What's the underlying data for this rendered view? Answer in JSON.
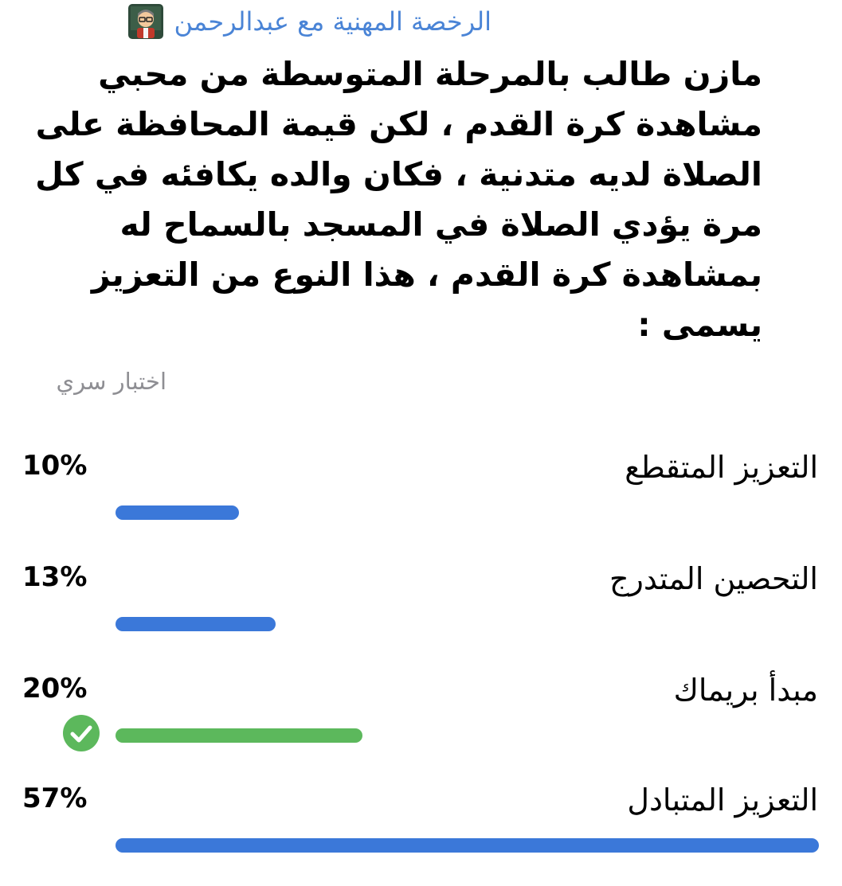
{
  "author": {
    "name": "الرخصة المهنية مع عبدالرحمن",
    "emoji_icon": "teacher-emoji-icon"
  },
  "question": "مازن طالب بالمرحلة المتوسطة من محبي مشاهدة كرة القدم ، لكن قيمة المحافظة على الصلاة لديه متدنية ، فكان والده يكافئه في كل مرة يؤدي الصلاة في المسجد بالسماح له بمشاهدة كرة القدم ، هذا النوع من التعزيز يسمى :",
  "poll_type": "اختبار سري",
  "colors": {
    "accent": "#3b78d9",
    "correct": "#5cb85c",
    "author": "#4a84d6",
    "muted": "#8e8e93"
  },
  "options": [
    {
      "label": "التعزيز المتقطع",
      "percent_text": "10%",
      "percent": 10,
      "correct": false
    },
    {
      "label": "التحصين المتدرج",
      "percent_text": "13%",
      "percent": 13,
      "correct": false
    },
    {
      "label": "مبدأ بريماك",
      "percent_text": "20%",
      "percent": 20,
      "correct": true,
      "icon": "check-circle-icon"
    },
    {
      "label": "التعزيز المتبادل",
      "percent_text": "57%",
      "percent": 57,
      "correct": false
    }
  ]
}
